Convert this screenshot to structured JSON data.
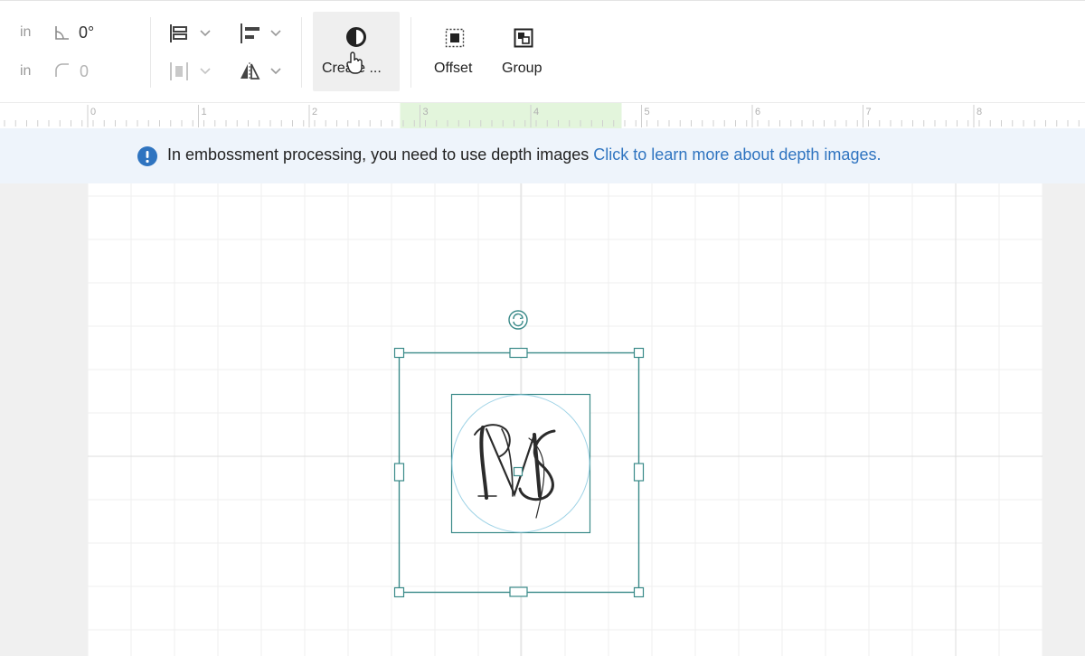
{
  "toolbar": {
    "row1": {
      "unit": "in",
      "angle_value": "0°"
    },
    "row2": {
      "unit": "in",
      "radius_value": "0"
    },
    "create_label": "Create ...",
    "offset_label": "Offset",
    "group_label": "Group"
  },
  "ruler": {
    "ticks": [
      "0",
      "1",
      "2",
      "3",
      "4",
      "5",
      "6",
      "7",
      "8"
    ],
    "highlight_range": [
      3,
      5
    ],
    "highlight_color": "#e3f5dc"
  },
  "banner": {
    "message": "In embossment processing, you need to use depth images",
    "link_text": "Click to learn more about depth images.",
    "info_color": "#2f74c0"
  },
  "canvas": {
    "selection_color": "#3a8a89",
    "image_name": "monogram-ms"
  }
}
